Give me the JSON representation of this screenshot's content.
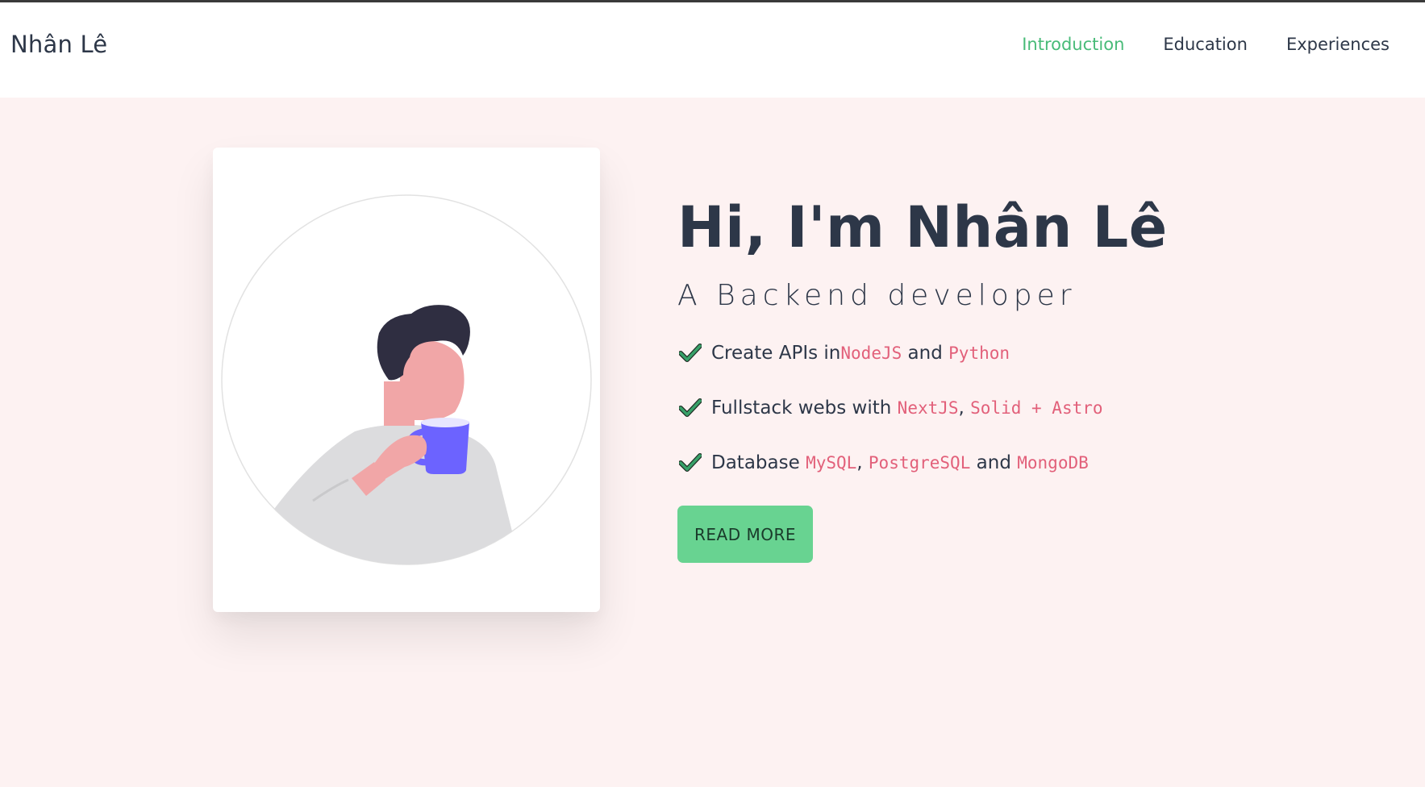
{
  "header": {
    "brand": "Nhân Lê",
    "nav": [
      {
        "label": "Introduction",
        "active": true
      },
      {
        "label": "Education",
        "active": false
      },
      {
        "label": "Experiences",
        "active": false
      }
    ]
  },
  "hero": {
    "title": "Hi, I'm Nhân Lê",
    "subtitle": "A Backend developer",
    "features": [
      {
        "t1": "Create APIs in ",
        "c1": "NodeJS",
        "t2": " and ",
        "c2": "Python"
      },
      {
        "t1": "Fullstack webs with ",
        "c1": "NextJS",
        "t2": ", ",
        "c2": "Solid + Astro"
      },
      {
        "t1": "Database ",
        "c1": "MySQL",
        "t2": ", ",
        "c2": "PostgreSQL",
        "t3": " and ",
        "c3": "MongoDB"
      }
    ],
    "cta_label": "READ MORE"
  },
  "colors": {
    "accent": "#48bb78",
    "button_bg": "#68d391",
    "hero_bg": "#fdf2f2",
    "code_text": "#e2607a",
    "check": "#38a169"
  },
  "icons": {
    "feature_bullet": "check-icon",
    "illustration": "person-drinking-coffee-illustration"
  }
}
